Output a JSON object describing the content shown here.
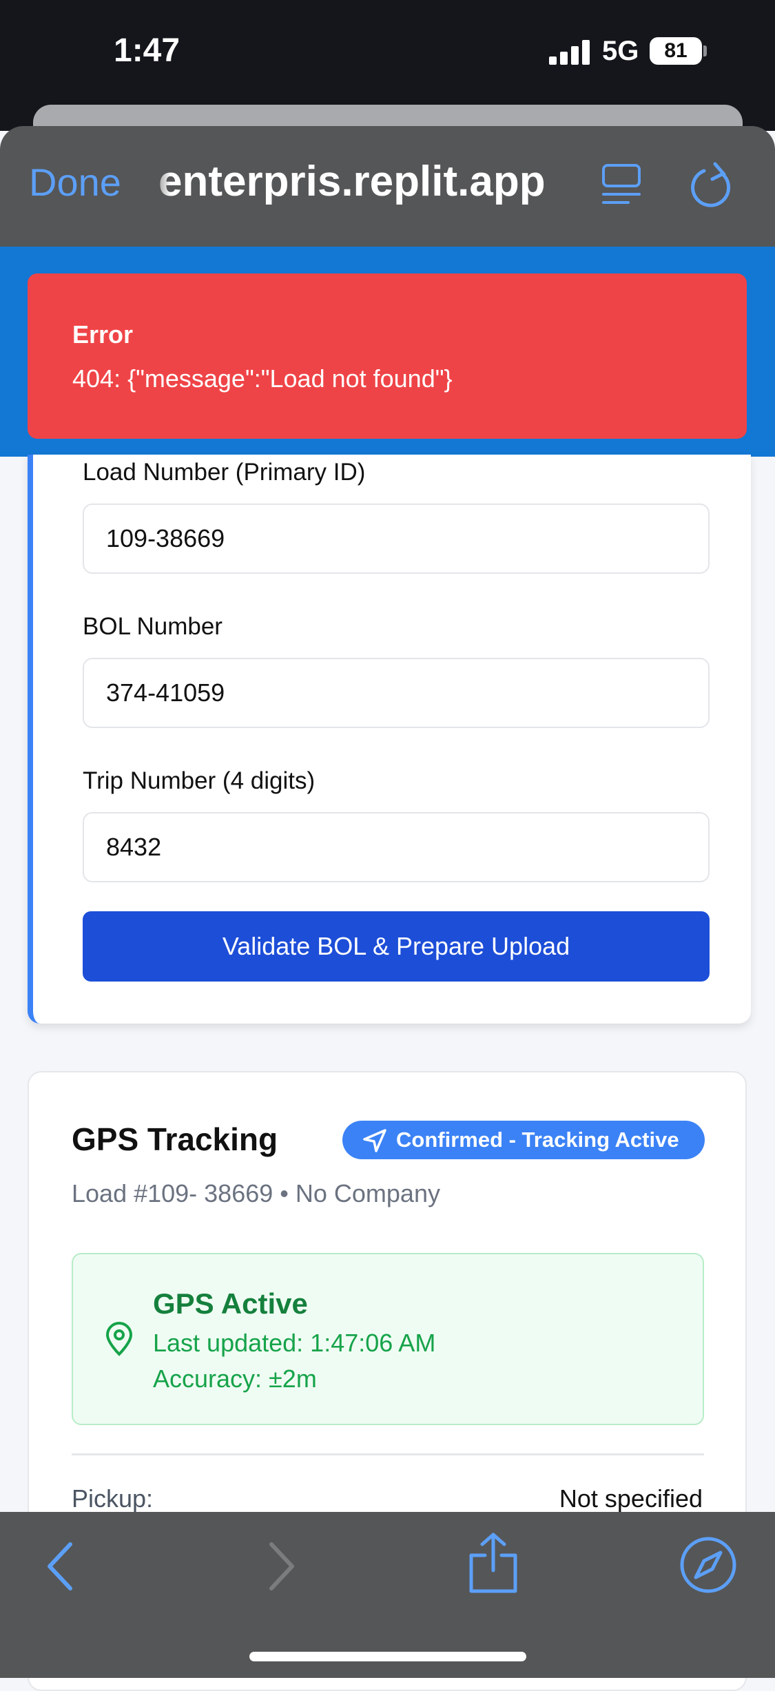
{
  "status_bar": {
    "time": "1:47",
    "network": "5G",
    "battery": "81"
  },
  "browser": {
    "done_label": "Done",
    "url": "enterpris.replit.app",
    "reader_icon": "reader-icon",
    "reload_icon": "reload-icon",
    "accent_color": "#5c9ff7"
  },
  "error_toast": {
    "title": "Error",
    "message": "404: {\"message\":\"Load not found\"}",
    "color": "#ef4447"
  },
  "form": {
    "load_number_label": "Load Number (Primary ID)",
    "load_number_value": "109-38669",
    "bol_number_label": "BOL Number",
    "bol_number_value": "374-41059",
    "trip_number_label": "Trip Number (4 digits)",
    "trip_number_value": "8432",
    "submit_label": "Validate BOL & Prepare Upload",
    "submit_color": "#1d4ed8"
  },
  "gps": {
    "title": "GPS Tracking",
    "badge": "Confirmed - Tracking Active",
    "subtitle": "Load #109- 38669 • No Company",
    "status_title": "GPS Active",
    "last_updated": "Last updated: 1:47:06 AM",
    "accuracy": "Accuracy: ±2m",
    "pickup_label": "Pickup:",
    "pickup_value": "Not specified",
    "status_color": "#15803d"
  },
  "toolbar": {
    "back_icon": "back-icon",
    "forward_icon": "forward-icon",
    "share_icon": "share-icon",
    "compass_icon": "compass-icon"
  }
}
